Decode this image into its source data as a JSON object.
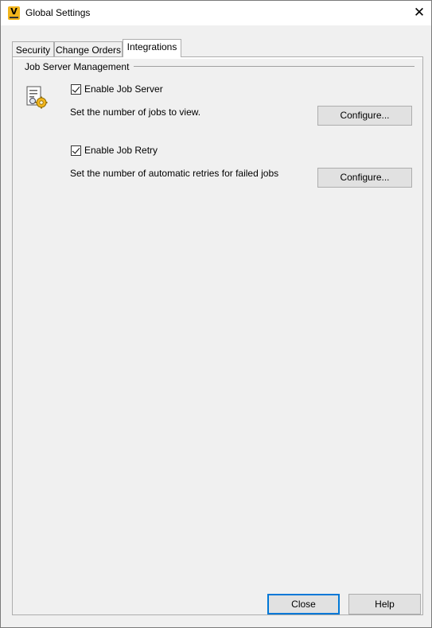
{
  "window": {
    "title": "Global Settings",
    "app_icon_letter": "V",
    "close_glyph": "✕",
    "accent_color": "#0078d7",
    "app_icon_color": "#f2b51c"
  },
  "tabs": [
    {
      "label": "Security",
      "selected": false
    },
    {
      "label": "Change Orders",
      "selected": false
    },
    {
      "label": "Integrations",
      "selected": true
    }
  ],
  "job_server": {
    "group_label": "Job Server Management",
    "icon": "job-server-gear-icon",
    "enable_job_server": {
      "label": "Enable Job Server",
      "checked": true
    },
    "jobs_description": "Set the number of jobs to view.",
    "configure_1": "Configure...",
    "enable_job_retry": {
      "label": "Enable Job Retry",
      "checked": true
    },
    "retry_description": "Set the number of automatic retries for failed jobs",
    "configure_2": "Configure..."
  },
  "footer": {
    "close_label": "Close",
    "help_label": "Help"
  }
}
